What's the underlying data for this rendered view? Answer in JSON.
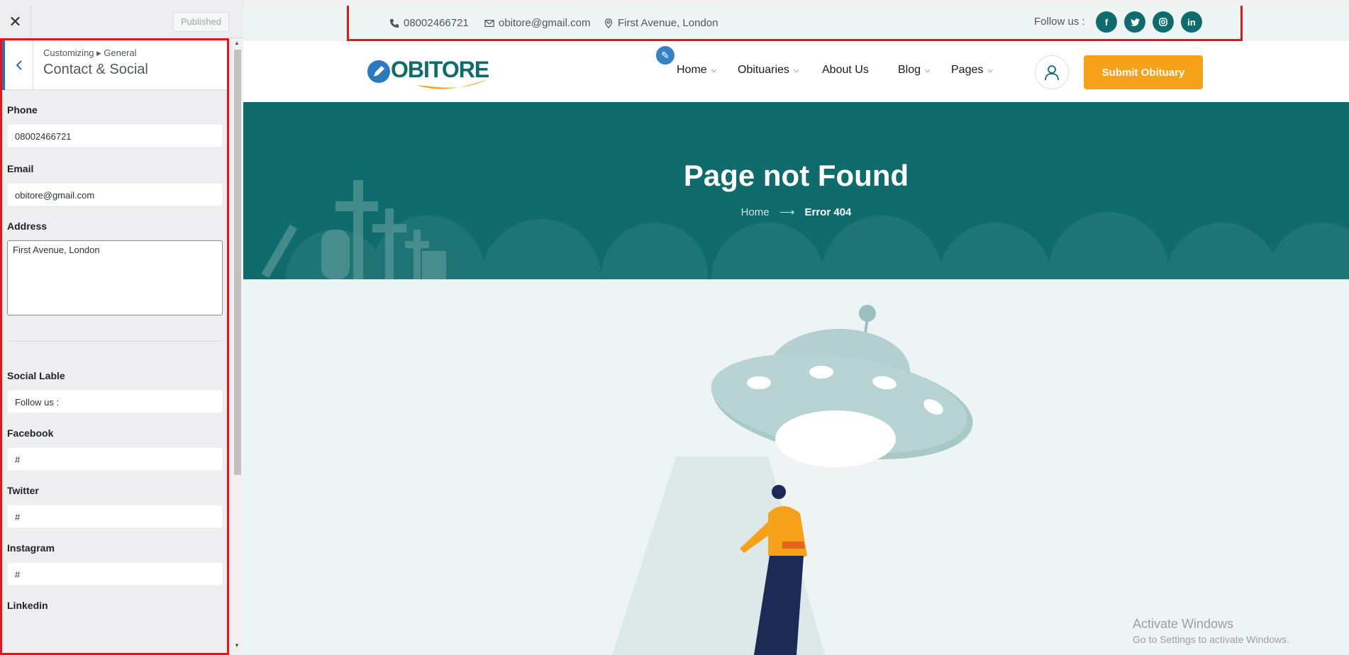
{
  "customizer": {
    "close_icon": "close-icon",
    "published_label": "Published",
    "breadcrumb": "Customizing ▸ General",
    "section_title": "Contact & Social",
    "fields": {
      "phone_label": "Phone",
      "phone_value": "08002466721",
      "email_label": "Email",
      "email_value": "obitore@gmail.com",
      "address_label": "Address",
      "address_value": "First Avenue, London",
      "social_label_label": "Social Lable",
      "social_label_value": "Follow us :",
      "facebook_label": "Facebook",
      "facebook_value": "#",
      "twitter_label": "Twitter",
      "twitter_value": "#",
      "instagram_label": "Instagram",
      "instagram_value": "#",
      "linkedin_label": "Linkedin"
    }
  },
  "topbar": {
    "phone": "08002466721",
    "email": "obitore@gmail.com",
    "address": "First Avenue, London",
    "follow_label": "Follow us :",
    "social": [
      "f",
      "t",
      "ig",
      "in"
    ]
  },
  "navbar": {
    "logo_text": "OBITORE",
    "items": [
      "Home",
      "Obituaries",
      "About Us",
      "Blog",
      "Pages"
    ],
    "submit_label": "Submit Obituary"
  },
  "hero": {
    "title": "Page not Found",
    "crumb_home": "Home",
    "crumb_current": "Error 404"
  },
  "watermark": {
    "line1": "Activate Windows",
    "line2": "Go to Settings to activate Windows."
  },
  "colors": {
    "brand_teal": "#0f6b6c",
    "accent_orange": "#f6a11a",
    "highlight_red": "#e3161f"
  }
}
